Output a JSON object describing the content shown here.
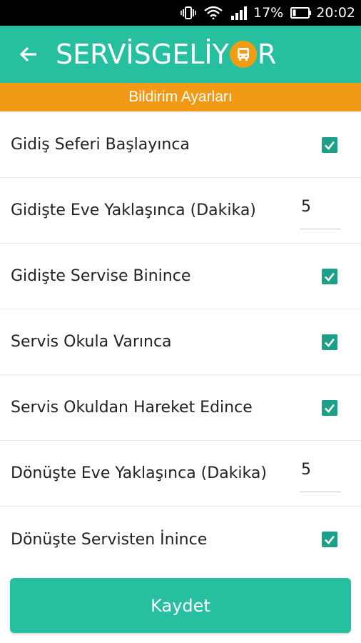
{
  "status_bar": {
    "battery_percent": "17%",
    "time": "20:02",
    "icons": [
      "vibrate-icon",
      "wifi-icon",
      "signal-icon",
      "battery-icon"
    ]
  },
  "app_bar": {
    "back_icon": "arrow-left-icon",
    "brand_part1": "SERVİSGELİY",
    "brand_part2": "R",
    "brand_logo_icon": "bus-icon",
    "brand_accent_color": "#F39C12",
    "color": "#26BFA0"
  },
  "sub_bar": {
    "title": "Bildirim Ayarları",
    "color": "#F29A16"
  },
  "settings": [
    {
      "label": "Gidiş Seferi Başlayınca",
      "type": "checkbox",
      "checked": true
    },
    {
      "label": "Gidişte Eve Yaklaşınca (Dakika)",
      "type": "number",
      "value": "5"
    },
    {
      "label": "Gidişte Servise Binince",
      "type": "checkbox",
      "checked": true
    },
    {
      "label": "Servis Okula Varınca",
      "type": "checkbox",
      "checked": true
    },
    {
      "label": "Servis Okuldan Hareket Edince",
      "type": "checkbox",
      "checked": true
    },
    {
      "label": "Dönüşte Eve Yaklaşınca (Dakika)",
      "type": "number",
      "value": "5"
    },
    {
      "label": "Dönüşte Servisten İnince",
      "type": "checkbox",
      "checked": true
    }
  ],
  "save_button": {
    "label": "Kaydet",
    "color": "#26BFA0"
  }
}
